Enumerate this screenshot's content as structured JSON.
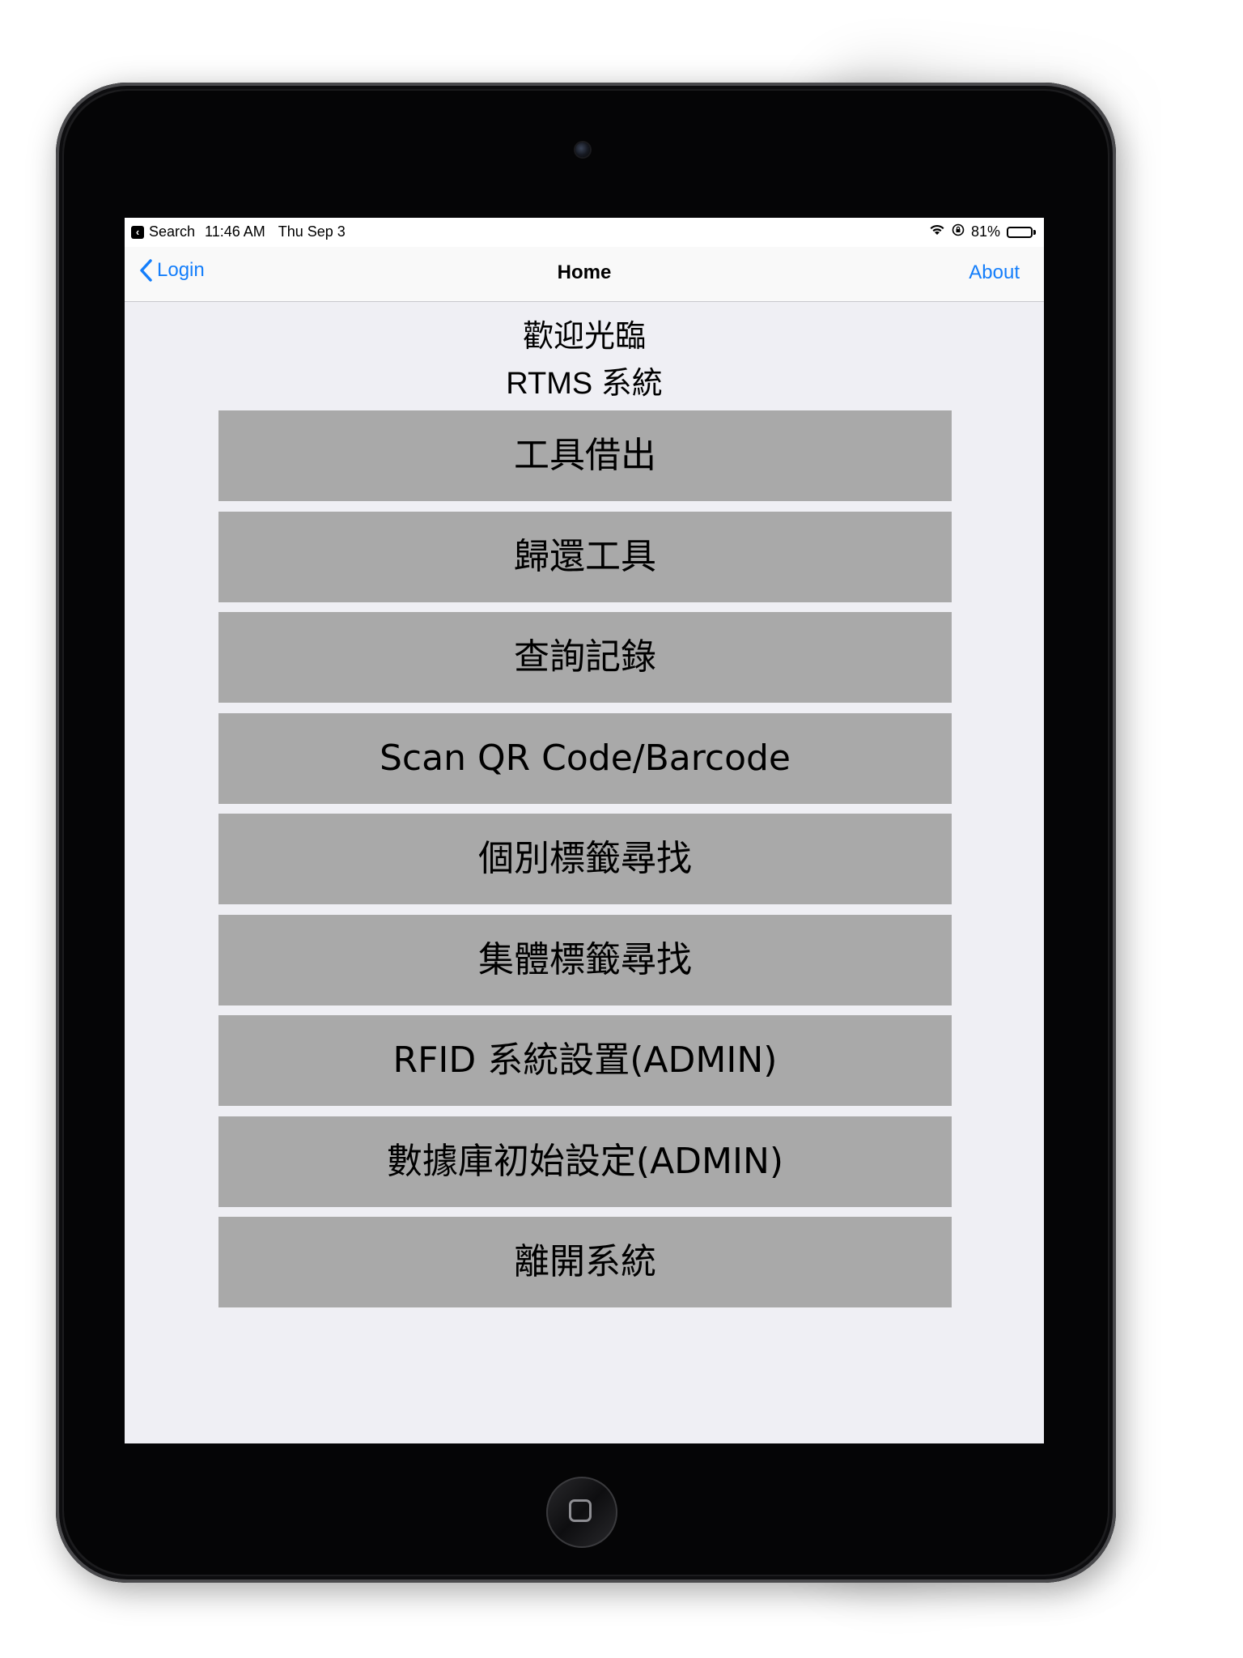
{
  "status_bar": {
    "back_app": "Search",
    "time": "11:46 AM",
    "date": "Thu Sep 3",
    "battery": "81%",
    "battery_level": 0.81
  },
  "nav_bar": {
    "back_label": "Login",
    "title": "Home",
    "right_label": "About"
  },
  "welcome": {
    "line1": "歡迎光臨",
    "line2": "RTMS 系統"
  },
  "menu": {
    "items": [
      {
        "label": "工具借出"
      },
      {
        "label": "歸還工具"
      },
      {
        "label": "查詢記錄"
      },
      {
        "label": "Scan QR Code/Barcode"
      },
      {
        "label": "個別標籤尋找"
      },
      {
        "label": "集體標籤尋找"
      },
      {
        "label": "RFID 系統設置(ADMIN)"
      },
      {
        "label": "數據庫初始設定(ADMIN)"
      },
      {
        "label": "離開系統"
      }
    ]
  },
  "colors": {
    "accent": "#147efb",
    "button_bg": "#a9a9a9",
    "screen_bg": "#efeff4"
  }
}
